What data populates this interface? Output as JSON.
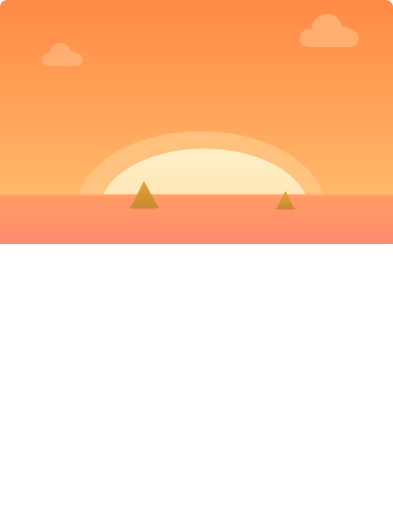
{
  "colors": {
    "sky_top": "#ff8a45",
    "sky_bottom": "#ffb86a",
    "halo": "#ffc888",
    "sun_top": "#fff0c8",
    "sun_bottom": "#ffd89e",
    "sea_top": "#ff9c64",
    "sea_bottom": "#ff8a70",
    "cloud": "#ffb377",
    "fin_top": "#e6a43a",
    "fin_bottom": "#c78a2f",
    "fin_shadow": "#d27f42",
    "background": "#ffffff"
  },
  "hero": {
    "scene": "sunset-over-sea",
    "fin_count": 2,
    "cloud_count": 2
  },
  "content": {}
}
